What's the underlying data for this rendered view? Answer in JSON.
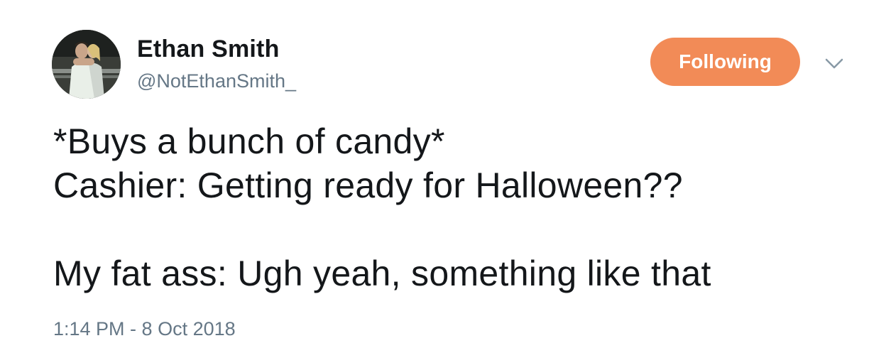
{
  "author": {
    "display_name": "Ethan Smith",
    "handle": "@NotEthanSmith_"
  },
  "follow_button": {
    "label": "Following",
    "color": "#f28b57"
  },
  "menu": {
    "icon": "chevron-down-icon"
  },
  "tweet": {
    "lines": [
      "*Buys a bunch of candy*",
      "Cashier: Getting ready for Halloween??",
      "",
      "My fat ass: Ugh yeah, something like that"
    ],
    "timestamp": "1:14 PM - 8 Oct 2018"
  }
}
